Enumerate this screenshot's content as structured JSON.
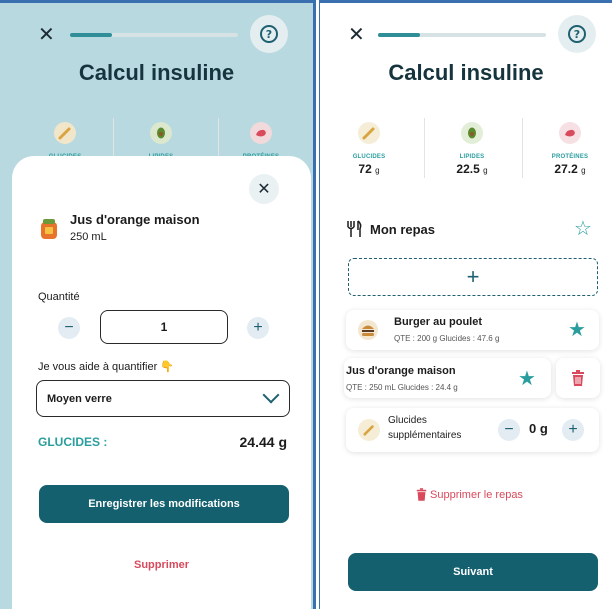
{
  "left": {
    "title": "Calcul insuline",
    "macros": [
      {
        "label": "GLUCIDES",
        "icon": "carrot-icon",
        "color": "#d9a441"
      },
      {
        "label": "LIPIDES",
        "icon": "avocado-icon",
        "color": "#5c8a2e"
      },
      {
        "label": "PROTÉINES",
        "icon": "meat-icon",
        "color": "#d84a5c"
      }
    ],
    "sheet": {
      "food_name": "Jus d'orange maison",
      "food_qty": "250 mL",
      "quantity_label": "Quantité",
      "quantity_value": "1",
      "minus": "−",
      "plus": "+",
      "helper_text": "Je vous aide à quantifier 👇",
      "select_value": "Moyen verre",
      "glucides_label": "GLUCIDES :",
      "glucides_value": "24.44 g",
      "save_button": "Enregistrer les modifications",
      "delete_link": "Supprimer"
    },
    "progress": 0.25
  },
  "right": {
    "title": "Calcul insuline",
    "progress": 0.25,
    "macros": [
      {
        "label": "GLUCIDES",
        "value": "72",
        "unit": "g",
        "icon": "carrot-icon",
        "color": "#d9a441"
      },
      {
        "label": "LIPIDES",
        "value": "22.5",
        "unit": "g",
        "icon": "avocado-icon",
        "color": "#5c8a2e"
      },
      {
        "label": "PROTÉINES",
        "value": "27.2",
        "unit": "g",
        "icon": "meat-icon",
        "color": "#d84a5c"
      }
    ],
    "meal_title": "Mon repas",
    "add_symbol": "+",
    "items": [
      {
        "name": "Burger au poulet",
        "detail": "QTE : 200 g Glucides : 47.6 g"
      },
      {
        "name": "Jus d'orange maison",
        "detail": "QTE : 250 mL Glucides : 24.4 g"
      }
    ],
    "extra": {
      "label_line1": "Glucides",
      "label_line2": "supplémentaires",
      "value": "0 g",
      "minus": "−",
      "plus": "+"
    },
    "delete_meal": "Supprimer le repas",
    "next_button": "Suivant"
  },
  "colors": {
    "accent": "#15606f",
    "teal": "#2a9d9e",
    "danger": "#d84a5c"
  }
}
